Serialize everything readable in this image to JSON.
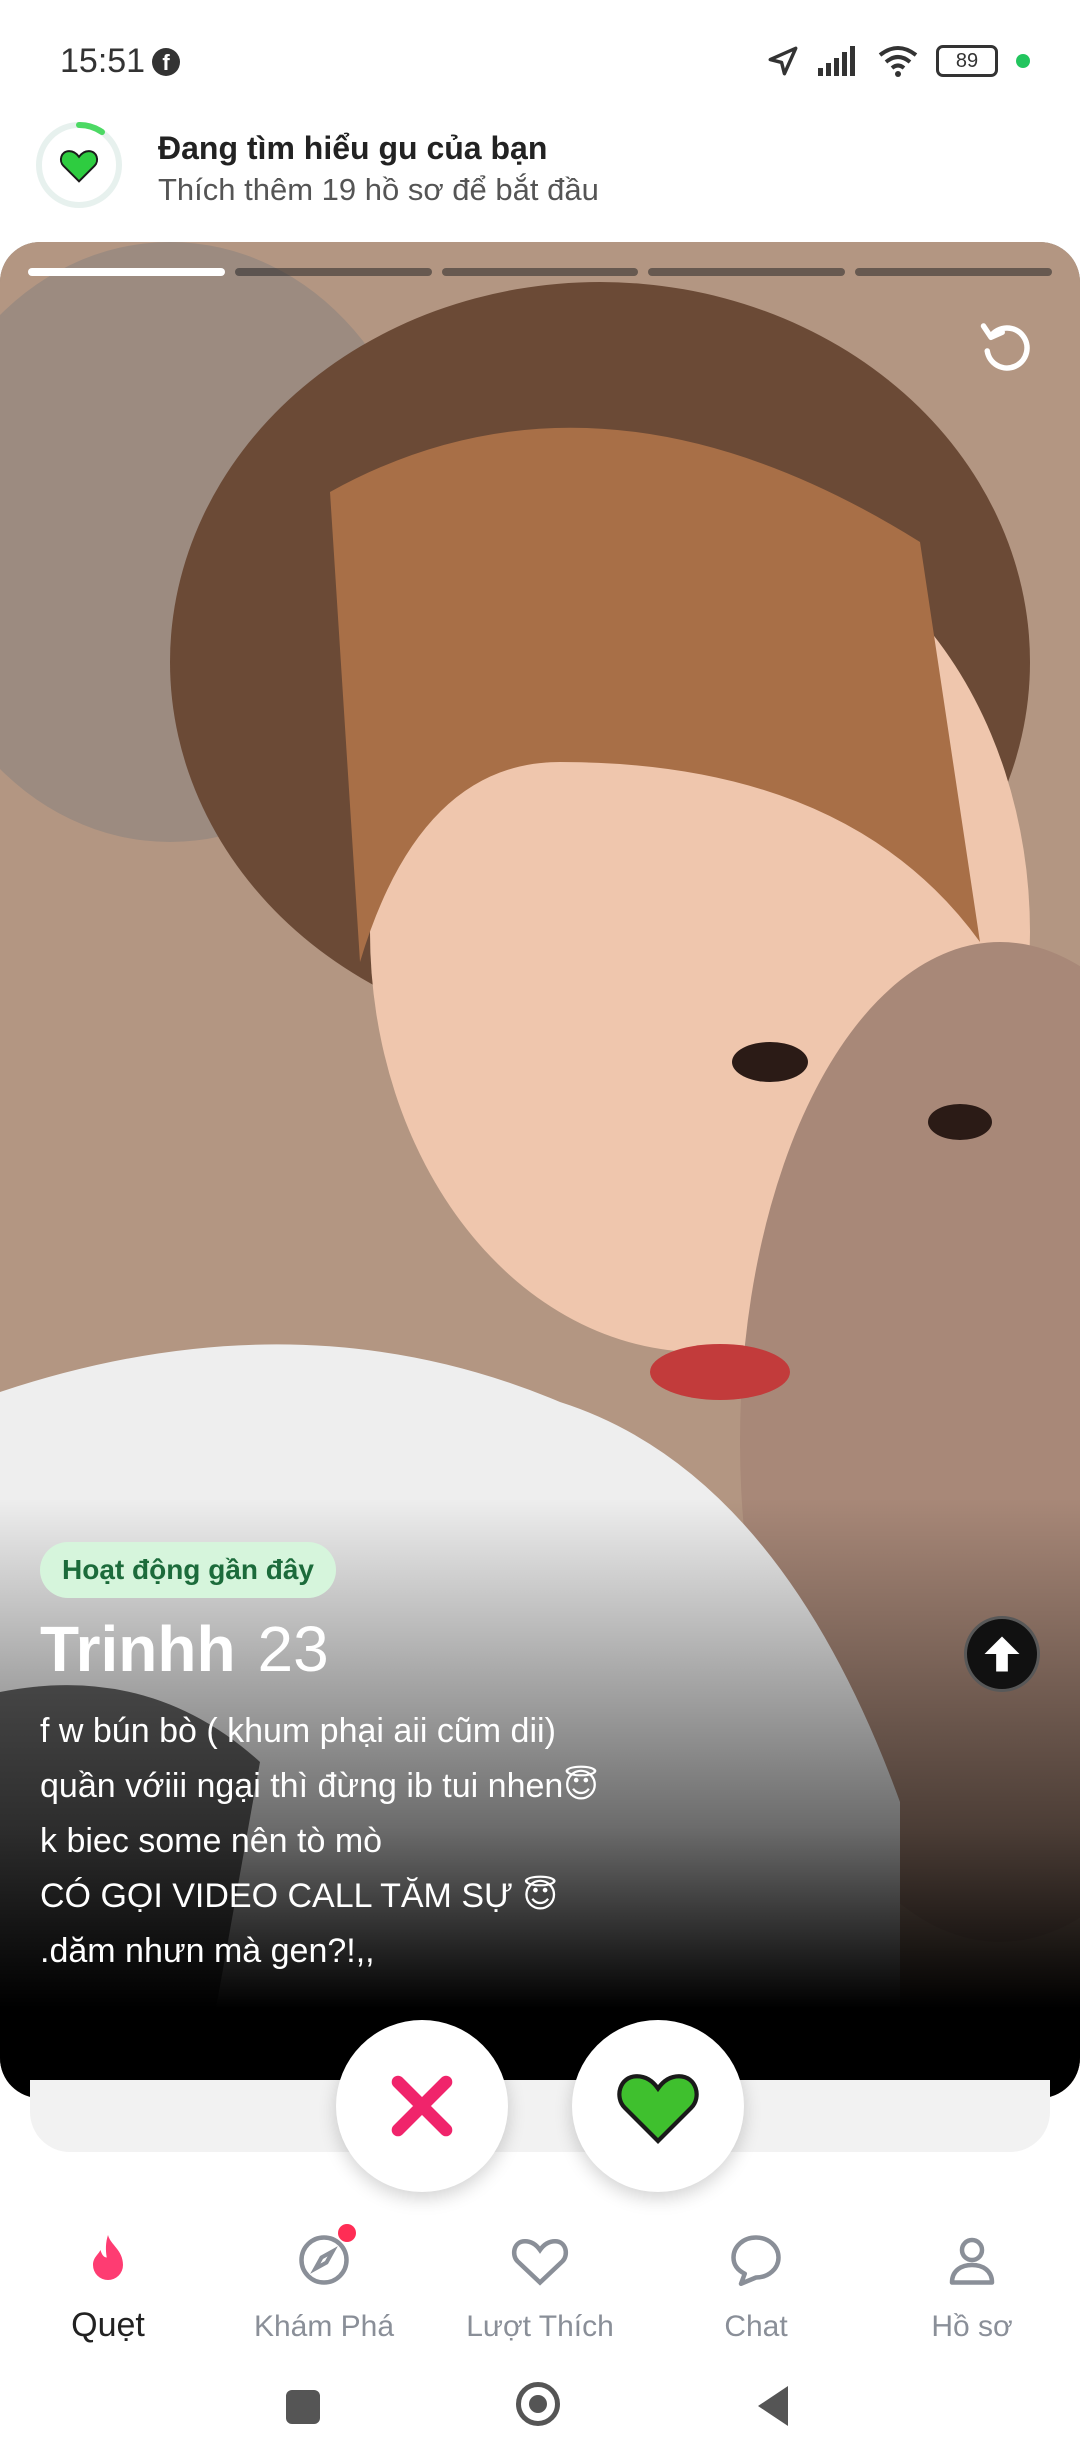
{
  "status_bar": {
    "time": "15:51",
    "battery": "89"
  },
  "prompt": {
    "title": "Đang tìm hiểu gu của bạn",
    "subtitle": "Thích thêm 19 hồ sơ để bắt đầu"
  },
  "card": {
    "photo_count": 5,
    "active_photo_index": 1,
    "activity_badge": "Hoạt động gần đây",
    "name": "Trinhh",
    "age": "23",
    "bio": [
      "f w bún bò ( khum phại aii cũm dii)",
      "quần vớiii ngại thì đừng ib tui nhen😇",
      "k biec some nên tò mò",
      "CÓ GỌI VIDEO CALL TĂM SỰ 😇",
      ".dăm nhưn mà gen?!,,"
    ]
  },
  "actions": {
    "nope_icon": "x-icon",
    "like_icon": "heart-icon",
    "like_color": "#3fc02e",
    "nope_color": "#f0246b"
  },
  "nav": {
    "items": [
      {
        "label": "Quẹt",
        "icon": "flame-icon",
        "active": true
      },
      {
        "label": "Khám Phá",
        "icon": "compass-icon",
        "notification": true
      },
      {
        "label": "Lượt Thích",
        "icon": "heart-outline-icon"
      },
      {
        "label": "Chat",
        "icon": "chat-bubble-icon"
      },
      {
        "label": "Hồ sơ",
        "icon": "person-icon"
      }
    ]
  },
  "colors": {
    "accent": "#fe3c72",
    "badge_bg": "#d6f5dc",
    "badge_text": "#1c6b3b"
  }
}
